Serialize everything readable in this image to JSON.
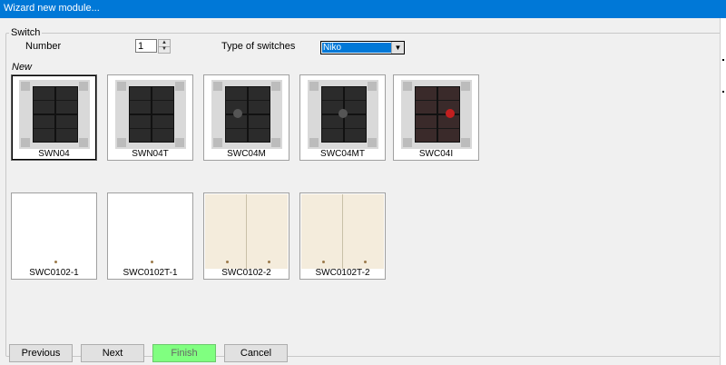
{
  "window": {
    "title": "Wizard new module..."
  },
  "group": {
    "legend": "Switch"
  },
  "number": {
    "label": "Number",
    "value": "1"
  },
  "type": {
    "label": "Type of switches",
    "selected": "Niko"
  },
  "section": {
    "new_label": "New"
  },
  "modules_top": [
    {
      "name": "SWN04",
      "selected": true,
      "led": "none"
    },
    {
      "name": "SWN04T",
      "selected": false,
      "led": "none"
    },
    {
      "name": "SWC04M",
      "selected": false,
      "led": "gray"
    },
    {
      "name": "SWC04MT",
      "selected": false,
      "led": "gray"
    },
    {
      "name": "SWC04I",
      "selected": false,
      "led": "red"
    }
  ],
  "modules_bottom": [
    {
      "name": "SWC0102-1",
      "color": "#ffffff",
      "double": false
    },
    {
      "name": "SWC0102T-1",
      "color": "#ffffff",
      "double": false
    },
    {
      "name": "SWC0102-2",
      "color": "#f4ecdc",
      "double": true
    },
    {
      "name": "SWC0102T-2",
      "color": "#f4ecdc",
      "double": true
    }
  ],
  "buttons": {
    "previous": "Previous",
    "next": "Next",
    "finish": "Finish",
    "cancel": "Cancel"
  },
  "colors": {
    "titlebar": "#0078d7",
    "finish": "#80ff80",
    "select_highlight": "#0078d7"
  }
}
